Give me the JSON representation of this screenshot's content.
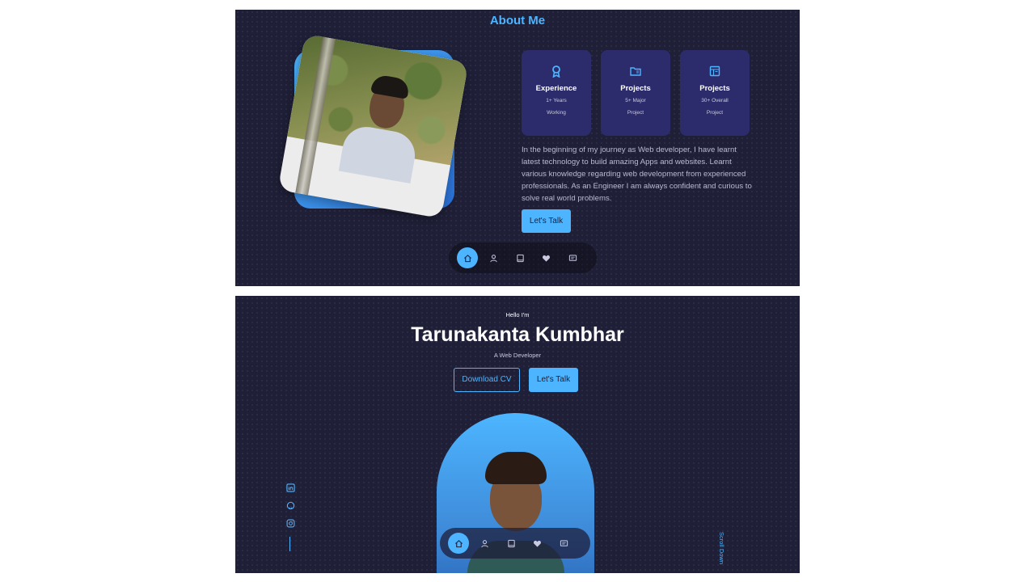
{
  "about": {
    "title": "About Me",
    "cards": [
      {
        "icon": "award-icon",
        "title": "Experience",
        "line1": "1+ Years",
        "line2": "Working"
      },
      {
        "icon": "folder-icon",
        "title": "Projects",
        "line1": "5+ Major",
        "line2": "Project"
      },
      {
        "icon": "projects-board-icon",
        "title": "Projects",
        "line1": "30+ Overall",
        "line2": "Project"
      }
    ],
    "paragraph": "In the beginning of my journey as Web developer, I have learnt latest technology to build amazing Apps and websites. Learnt various knowledge regarding web development from experienced professionals. As an Engineer I am always confident and curious to solve real world problems.",
    "cta_label": "Let's Talk"
  },
  "hero": {
    "greeting": "Hello I'm",
    "name": "Tarunakanta Kumbhar",
    "role": "A Web Developer",
    "download_label": "Download CV",
    "talk_label": "Let's Talk",
    "scroll_label": "Scroll Down",
    "socials": [
      "linkedin-icon",
      "github-icon",
      "instagram-icon"
    ]
  },
  "nav": {
    "items": [
      "home-icon",
      "user-icon",
      "book-icon",
      "services-icon",
      "message-icon"
    ],
    "active_index": 0
  },
  "colors": {
    "background": "#1f1f38",
    "accent": "#4db5ff",
    "card": "#2c2c6c"
  }
}
